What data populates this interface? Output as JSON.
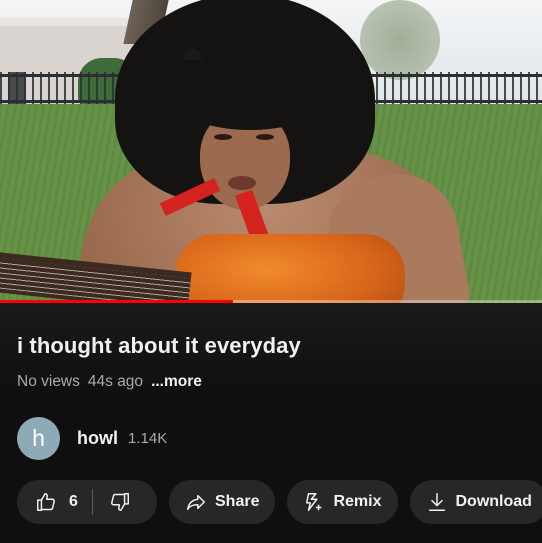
{
  "video": {
    "progress_fraction": 0.43
  },
  "title": "i thought about it everyday",
  "meta": {
    "views": "No views",
    "age": "44s ago",
    "more": "...more"
  },
  "channel": {
    "avatar_letter": "h",
    "avatar_color": "#8eaab7",
    "name": "howl",
    "subscribers": "1.14K"
  },
  "actions": {
    "like_count": "6",
    "share_label": "Share",
    "remix_label": "Remix",
    "download_label": "Download"
  },
  "colors": {
    "background": "#0f0f0f",
    "pill": "#272727",
    "progress": "#ff0000"
  },
  "icons": [
    "thumbs-up-icon",
    "thumbs-down-icon",
    "share-arrow-icon",
    "remix-icon",
    "download-icon"
  ]
}
